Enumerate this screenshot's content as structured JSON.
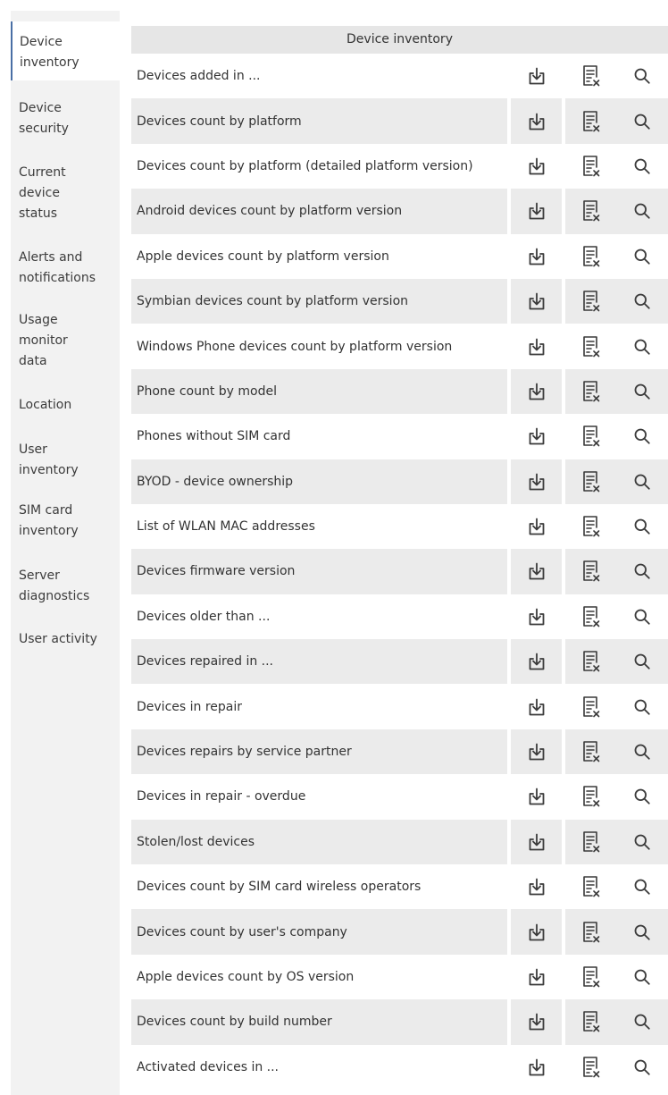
{
  "sidebar": {
    "items": [
      {
        "lines": [
          "Device",
          "inventory"
        ],
        "active": true
      },
      {
        "lines": [
          "Device",
          "security"
        ]
      },
      {
        "lines": [
          "Current",
          "device",
          "status"
        ]
      },
      {
        "lines": [
          "Alerts and",
          "notifications"
        ]
      },
      {
        "lines": [
          "Usage",
          "monitor",
          "data"
        ]
      },
      {
        "lines": [
          "Location"
        ]
      },
      {
        "lines": [
          "User",
          "inventory"
        ]
      },
      {
        "lines": [
          "SIM card",
          "inventory"
        ]
      },
      {
        "lines": [
          "Server",
          "diagnostics"
        ]
      },
      {
        "lines": [
          "User activity"
        ]
      }
    ]
  },
  "main": {
    "title": "Device inventory",
    "icons": {
      "export": "download-icon",
      "report": "report-delete-icon",
      "view": "search-icon"
    },
    "rows": [
      {
        "label": "Devices added in ..."
      },
      {
        "label": "Devices count by platform"
      },
      {
        "label": "Devices count by platform (detailed platform version)"
      },
      {
        "label": "Android devices count by platform version"
      },
      {
        "label": "Apple devices count by platform version"
      },
      {
        "label": "Symbian devices count by platform version"
      },
      {
        "label": "Windows Phone devices count by platform version"
      },
      {
        "label": "Phone count by model"
      },
      {
        "label": "Phones without SIM card"
      },
      {
        "label": "BYOD - device ownership"
      },
      {
        "label": "List of WLAN MAC addresses"
      },
      {
        "label": "Devices firmware version"
      },
      {
        "label": "Devices older than ..."
      },
      {
        "label": "Devices repaired in ..."
      },
      {
        "label": "Devices in repair"
      },
      {
        "label": "Devices repairs by service partner"
      },
      {
        "label": "Devices in repair - overdue"
      },
      {
        "label": "Stolen/lost devices"
      },
      {
        "label": "Devices count by SIM card wireless operators"
      },
      {
        "label": "Devices count by user's company"
      },
      {
        "label": "Apple devices count by OS version"
      },
      {
        "label": "Devices count by build number"
      },
      {
        "label": "Activated devices in ..."
      }
    ]
  },
  "colors": {
    "sidebar_bg": "#f2f2f2",
    "active_accent": "#4a6fa5",
    "row_shade": "#ebebeb",
    "header_bg": "#e6e6e6",
    "icon_color": "#3a3a3a"
  }
}
